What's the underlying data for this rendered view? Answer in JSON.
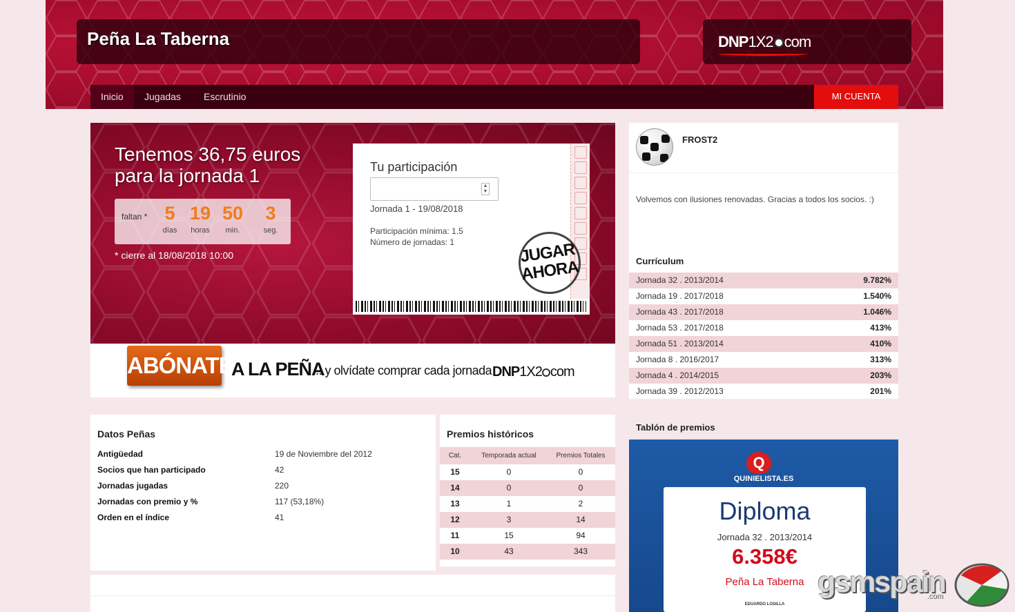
{
  "header": {
    "title": "Peña La Taberna",
    "logo": {
      "prefix": "DNP",
      "middle": "1X2",
      "suffix": "com"
    }
  },
  "nav": {
    "items": [
      "Inicio",
      "Jugadas",
      "Escrutinio"
    ],
    "account": "MI CUENTA"
  },
  "hero": {
    "title_line1": "Tenemos 36,75 euros",
    "title_line2": "para la jornada 1",
    "countdown": {
      "label": "faltan *",
      "days": "5",
      "days_label": "días",
      "hours": "19",
      "hours_label": "horas",
      "minutes": "50",
      "minutes_label": "min.",
      "seconds": "3",
      "seconds_label": "seg."
    },
    "close_note": "* cierre al 18/08/2018 10:00"
  },
  "ticket": {
    "title": "Tu participación",
    "input_value": "",
    "jornada": "Jornada 1 - 19/08/2018",
    "min": "Participación mínima: 1.5",
    "num": "Número de jornadas: 1",
    "cta_line1": "JUGAR",
    "cta_line2": "AHORA"
  },
  "abonate": {
    "button": "ABÓNATE",
    "pena": "A LA PEÑA",
    "text": "...y olvídate comprar cada jornada",
    "logo": {
      "prefix": "DNP",
      "middle": "1X2",
      "suffix": "com"
    }
  },
  "datos": {
    "title": "Datos Peñas",
    "rows": [
      {
        "k": "Antigüedad",
        "v": "19 de Noviembre del 2012"
      },
      {
        "k": "Socios que han participado",
        "v": "42"
      },
      {
        "k": "Jornadas jugadas",
        "v": "220"
      },
      {
        "k": "Jornadas con premio y %",
        "v": "117 (53,18%)"
      },
      {
        "k": "Orden en el índice",
        "v": "41"
      }
    ]
  },
  "premios": {
    "title": "Premios históricos",
    "headers": [
      "Cat.",
      "Temporada actual",
      "Premios Totales"
    ],
    "rows": [
      [
        "15",
        "0",
        "0"
      ],
      [
        "14",
        "0",
        "0"
      ],
      [
        "13",
        "1",
        "2"
      ],
      [
        "12",
        "3",
        "14"
      ],
      [
        "11",
        "15",
        "94"
      ],
      [
        "10",
        "43",
        "343"
      ]
    ]
  },
  "profile": {
    "username": "FROST2",
    "bio": "Volvemos con ilusiones renovadas. Gracias a todos los socios. :)",
    "curriculum_title": "Currículum",
    "curriculum": [
      {
        "j": "Jornada 32 . 2013/2014",
        "p": "9.782%"
      },
      {
        "j": "Jornada 19 . 2017/2018",
        "p": "1.540%"
      },
      {
        "j": "Jornada 43 . 2017/2018",
        "p": "1.046%"
      },
      {
        "j": "Jornada 53 . 2017/2018",
        "p": "413%"
      },
      {
        "j": "Jornada 51 . 2013/2014",
        "p": "410%"
      },
      {
        "j": "Jornada 8 . 2016/2017",
        "p": "313%"
      },
      {
        "j": "Jornada 4 . 2014/2015",
        "p": "203%"
      },
      {
        "j": "Jornada 39 . 2012/2013",
        "p": "201%"
      }
    ]
  },
  "tablon": {
    "title": "Tablón de premios",
    "brand": "QUINIELISTA.ES",
    "diploma": "Diploma",
    "jornada": "Jornada 32 . 2013/2014",
    "amount": "6.358€",
    "pena": "Peña La Taberna",
    "signature": "EDUARDO LOSILLA"
  },
  "watermark": {
    "text": "gsmspain",
    "suffix": ".com"
  },
  "colors": {
    "brand_red": "#a50c2d",
    "account": "#e30d0d",
    "countdown": "#f07d1a",
    "diploma_amount": "#d10b1b"
  }
}
